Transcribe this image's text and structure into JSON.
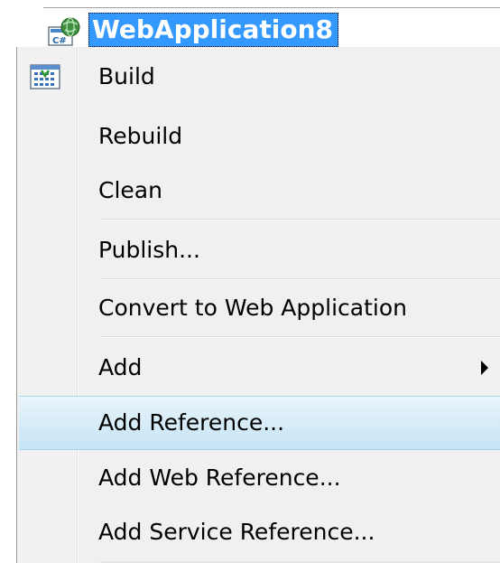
{
  "project": {
    "name": "WebApplication8",
    "icon": "web-project-icon"
  },
  "menu": {
    "items": [
      {
        "label": "Build",
        "icon": "build-icon",
        "has_submenu": false,
        "highlighted": false
      },
      {
        "label": "Rebuild",
        "icon": "",
        "has_submenu": false,
        "highlighted": false
      },
      {
        "label": "Clean",
        "icon": "",
        "has_submenu": false,
        "highlighted": false
      },
      {
        "label": "Publish...",
        "icon": "",
        "has_submenu": false,
        "highlighted": false
      },
      {
        "label": "Convert to Web Application",
        "icon": "",
        "has_submenu": false,
        "highlighted": false
      },
      {
        "label": "Add",
        "icon": "",
        "has_submenu": true,
        "highlighted": false
      },
      {
        "label": "Add Reference...",
        "icon": "",
        "has_submenu": false,
        "highlighted": true
      },
      {
        "label": "Add Web Reference...",
        "icon": "",
        "has_submenu": false,
        "highlighted": false
      },
      {
        "label": "Add Service Reference...",
        "icon": "",
        "has_submenu": false,
        "highlighted": false
      }
    ]
  },
  "colors": {
    "selection": "#3399ff",
    "menu_background": "#f0f0f0",
    "hover_highlight": "#c5e4f6"
  }
}
